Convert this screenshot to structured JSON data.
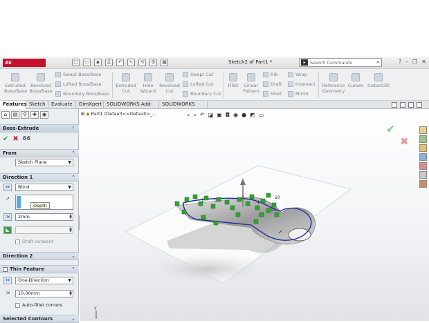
{
  "app": {
    "logo": "3S SOLIDWORKS",
    "doc_title": "Sketch2 of Part1 *"
  },
  "search": {
    "placeholder": "Search Commands"
  },
  "ribbon": {
    "extruded_boss": "Extruded Boss/Base",
    "revolved_boss": "Revolved Boss/Base",
    "swept_boss": "Swept Boss/Base",
    "lofted_boss": "Lofted Boss/Base",
    "boundary_boss": "Boundary Boss/Base",
    "extruded_cut": "Extruded Cut",
    "hole_wizard": "Hole Wizard",
    "revolved_cut": "Revolved Cut",
    "swept_cut": "Swept Cut",
    "lofted_cut": "Lofted Cut",
    "boundary_cut": "Boundary Cut",
    "fillet": "Fillet",
    "linear_pattern": "Linear Pattern",
    "rib": "Rib",
    "draft": "Draft",
    "shell": "Shell",
    "wrap": "Wrap",
    "intersect": "Intersect",
    "mirror": "Mirror",
    "reference_geometry": "Reference Geometry",
    "curves": "Curves",
    "instant3d": "Instant3D"
  },
  "tabs": [
    "Features",
    "Sketch",
    "Evaluate",
    "DimXpert",
    "SOLIDWORKS Add-Ins",
    "SOLIDWORKS MBD"
  ],
  "property_manager": {
    "title": "Boss-Extrude",
    "from": {
      "header": "From",
      "value": "Sketch Plane"
    },
    "direction1": {
      "header": "Direction 1",
      "end_condition": "Blind",
      "tooltip": "Depth",
      "depth": "2mm",
      "draft_outward": "Draft outward"
    },
    "direction2": {
      "header": "Direction 2"
    },
    "thin_feature": {
      "header": "Thin Feature",
      "type": "One-Direction",
      "thickness": "10.00mm",
      "auto_fillet": "Auto-fillet corners"
    },
    "selected_contours": {
      "header": "Selected Contours"
    }
  },
  "feature_tree": {
    "root": "Part1  (Default<<Default>_..."
  },
  "colors": {
    "accent": "#c8102e",
    "sketch": "#2233aa",
    "relations": "#22a022"
  }
}
